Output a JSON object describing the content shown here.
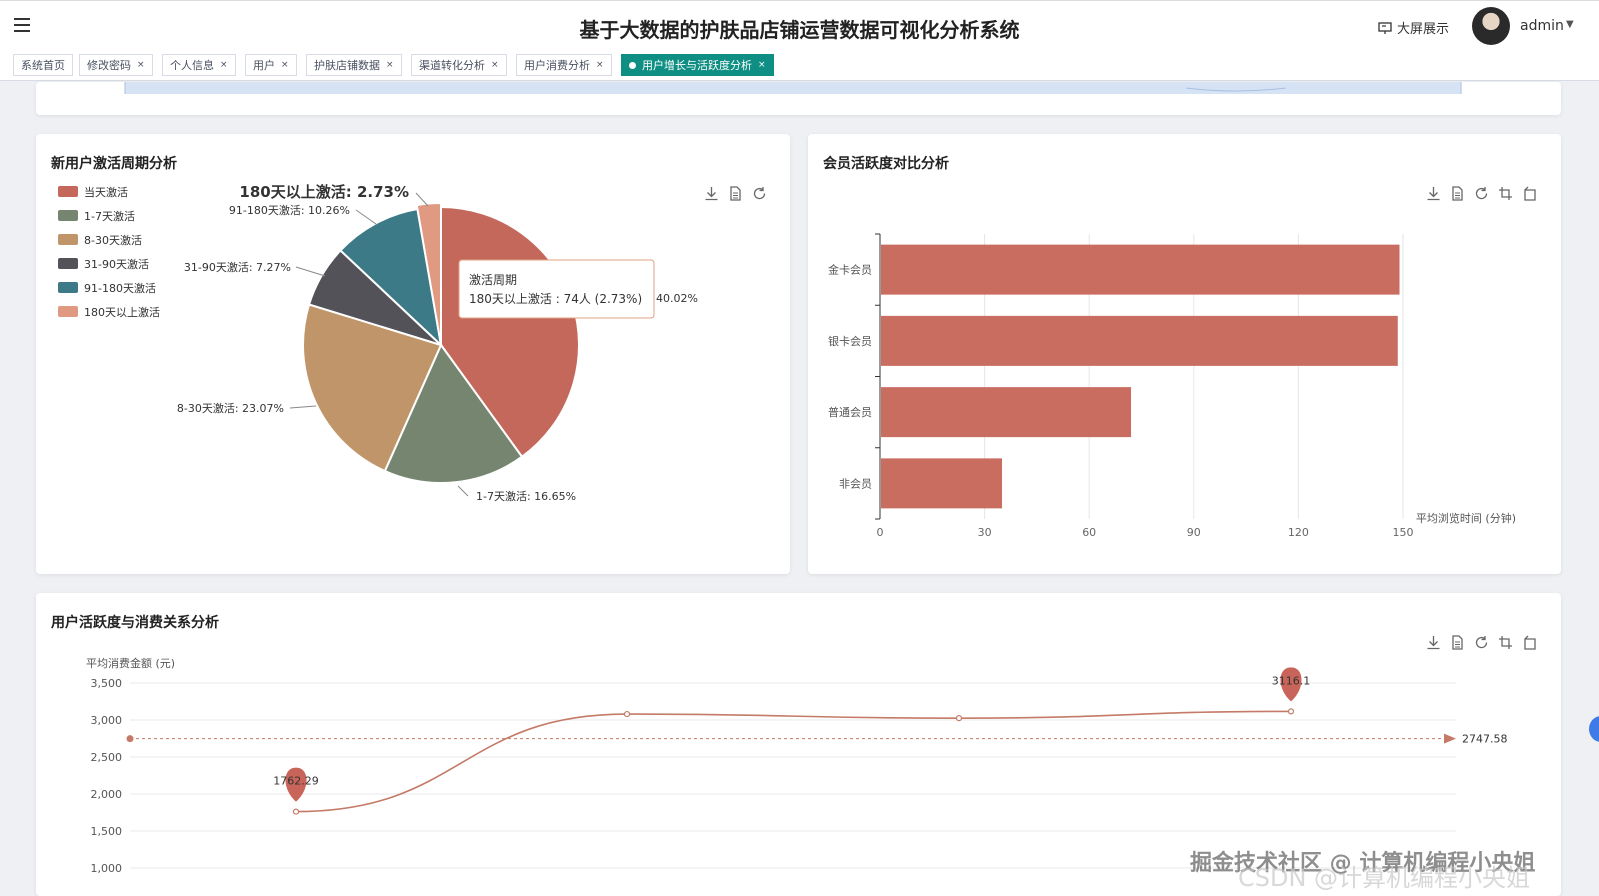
{
  "header": {
    "title": "基于大数据的护肤品店铺运营数据可视化分析系统",
    "big_screen_label": "大屏展示",
    "user_name": "admin"
  },
  "tabs": [
    {
      "label": "系统首页",
      "closable": false,
      "active": false
    },
    {
      "label": "修改密码",
      "closable": true,
      "active": false
    },
    {
      "label": "个人信息",
      "closable": true,
      "active": false
    },
    {
      "label": "用户",
      "closable": true,
      "active": false
    },
    {
      "label": "护肤店铺数据",
      "closable": true,
      "active": false
    },
    {
      "label": "渠道转化分析",
      "closable": true,
      "active": false
    },
    {
      "label": "用户消费分析",
      "closable": true,
      "active": false
    },
    {
      "label": "用户增长与活跃度分析",
      "closable": true,
      "active": true
    }
  ],
  "tab_close_glyph": "×",
  "colors": {
    "primary": "#0f8f83",
    "bar": "#c96d60",
    "line": "#c47a66",
    "pie": [
      "#c4685c",
      "#768570",
      "#c0956a",
      "#535259",
      "#3d7a88",
      "#e09a82"
    ]
  },
  "chart_data": [
    {
      "type": "pie",
      "title": "新用户激活周期分析",
      "legend": [
        "当天激活",
        "1-7天激活",
        "8-30天激活",
        "31-90天激活",
        "91-180天激活",
        "180天以上激活"
      ],
      "values": [
        40.02,
        16.65,
        23.07,
        7.27,
        10.26,
        2.73
      ],
      "labels": [
        "40.02%",
        "1-7天激活: 16.65%",
        "8-30天激活: 23.07%",
        "31-90天激活: 7.27%",
        "91-180天激活: 10.26%",
        "180天以上激活: 2.73%"
      ],
      "legend_position": "top-left",
      "tooltip": {
        "title": "激活周期",
        "text": "180天以上激活 : 74人 (2.73%)"
      }
    },
    {
      "type": "bar",
      "orientation": "horizontal",
      "title": "会员活跃度对比分析",
      "categories": [
        "金卡会员",
        "银卡会员",
        "普通会员",
        "非会员"
      ],
      "values": [
        149,
        148.5,
        72,
        35
      ],
      "xlabel": "平均浏览时间 (分钟)",
      "xlim": [
        0,
        150
      ],
      "ticks": [
        "0",
        "30",
        "60",
        "90",
        "120",
        "150"
      ],
      "grid": true
    },
    {
      "type": "line",
      "title": "用户活跃度与消费关系分析",
      "ylabel": "平均消费金额 (元)",
      "yticks": [
        "1,000",
        "1,500",
        "2,000",
        "2,500",
        "3,000",
        "3,500"
      ],
      "ylim": [
        1000,
        3500
      ],
      "values": [
        1762.29,
        3080,
        3025,
        3116.1
      ],
      "average": 2747.58,
      "average_label": "2747.58",
      "min_label": "1762.29",
      "max_label": "3116.1",
      "grid": true
    }
  ],
  "watermark": {
    "line1": "掘金技术社区 @ 计算机编程小央姐",
    "line2": "CSDN @计算机编程小央姐"
  }
}
